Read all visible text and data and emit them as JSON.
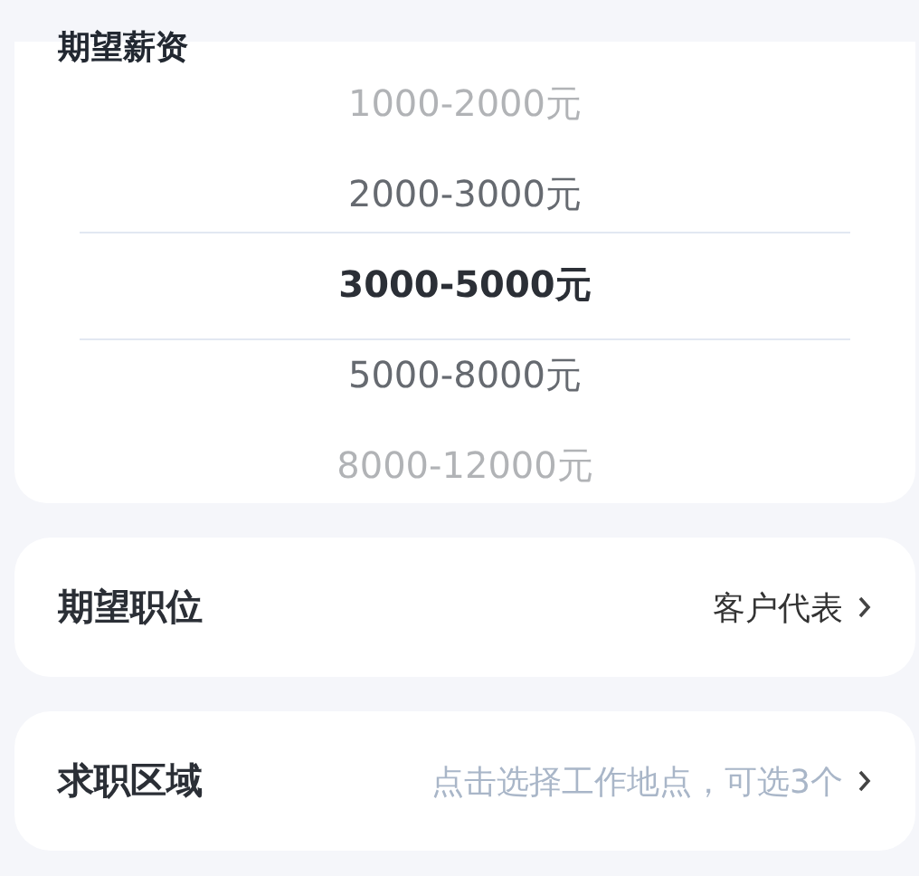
{
  "salary": {
    "title": "期望薪资",
    "options": [
      {
        "label": "1000-2000元",
        "selected": false
      },
      {
        "label": "2000-3000元",
        "selected": false
      },
      {
        "label": "3000-5000元",
        "selected": true
      },
      {
        "label": "5000-8000元",
        "selected": false
      },
      {
        "label": "8000-12000元",
        "selected": false
      }
    ]
  },
  "rows": [
    {
      "label": "期望职位",
      "value": "客户代表",
      "kind": "value"
    },
    {
      "label": "求职区域",
      "value": "点击选择工作地点，可选3个",
      "kind": "placeholder"
    }
  ]
}
